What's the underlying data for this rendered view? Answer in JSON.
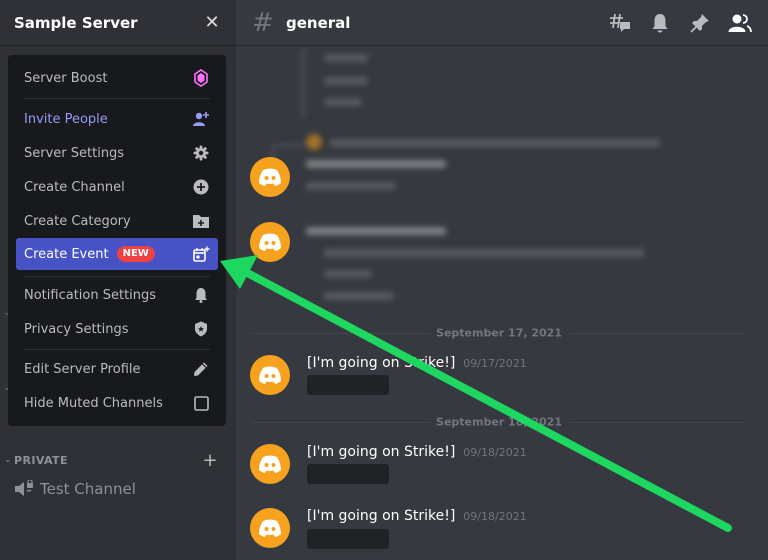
{
  "server": {
    "name": "Sample Server",
    "close_icon": "close-icon"
  },
  "menu": {
    "items": [
      {
        "label": "Server Boost",
        "icon": "boost-gem-icon",
        "color": "#ff73fa"
      },
      {
        "label": "Invite People",
        "icon": "add-person-icon",
        "color": "#949cf7"
      },
      {
        "label": "Server Settings",
        "icon": "gear-icon"
      },
      {
        "label": "Create Channel",
        "icon": "plus-circle-icon"
      },
      {
        "label": "Create Category",
        "icon": "folder-plus-icon"
      },
      {
        "label": "Create Event",
        "badge": "NEW",
        "icon": "calendar-plus-icon",
        "active": true
      },
      {
        "label": "Notification Settings",
        "icon": "bell-icon"
      },
      {
        "label": "Privacy Settings",
        "icon": "shield-icon"
      },
      {
        "label": "Edit Server Profile",
        "icon": "pencil-icon"
      },
      {
        "label": "Hide Muted Channels",
        "icon": "checkbox-icon",
        "checked": false
      }
    ]
  },
  "sidebar": {
    "category": "PRIVATE",
    "channel": "Test Channel",
    "channel_icon": "locked-voice-icon"
  },
  "channel": {
    "name": "general",
    "toolbar_icons": [
      "threads-icon",
      "bell-icon",
      "pin-icon",
      "members-icon"
    ]
  },
  "messages": {
    "dividers": [
      "September 17, 2021",
      "September 18, 2021"
    ],
    "items": [
      {
        "user": "[I'm going on Strike!]",
        "time": "09/17/2021"
      },
      {
        "user": "[I'm going on Strike!]",
        "time": "09/18/2021"
      },
      {
        "user": "[I'm going on Strike!]",
        "time": "09/18/2021"
      }
    ]
  },
  "annotation": {
    "arrow_color": "#1ed760",
    "points_to": "Create Event"
  },
  "colors": {
    "accent": "#4752c4",
    "badge": "#ed4245",
    "avatar": "#f6a21e"
  }
}
